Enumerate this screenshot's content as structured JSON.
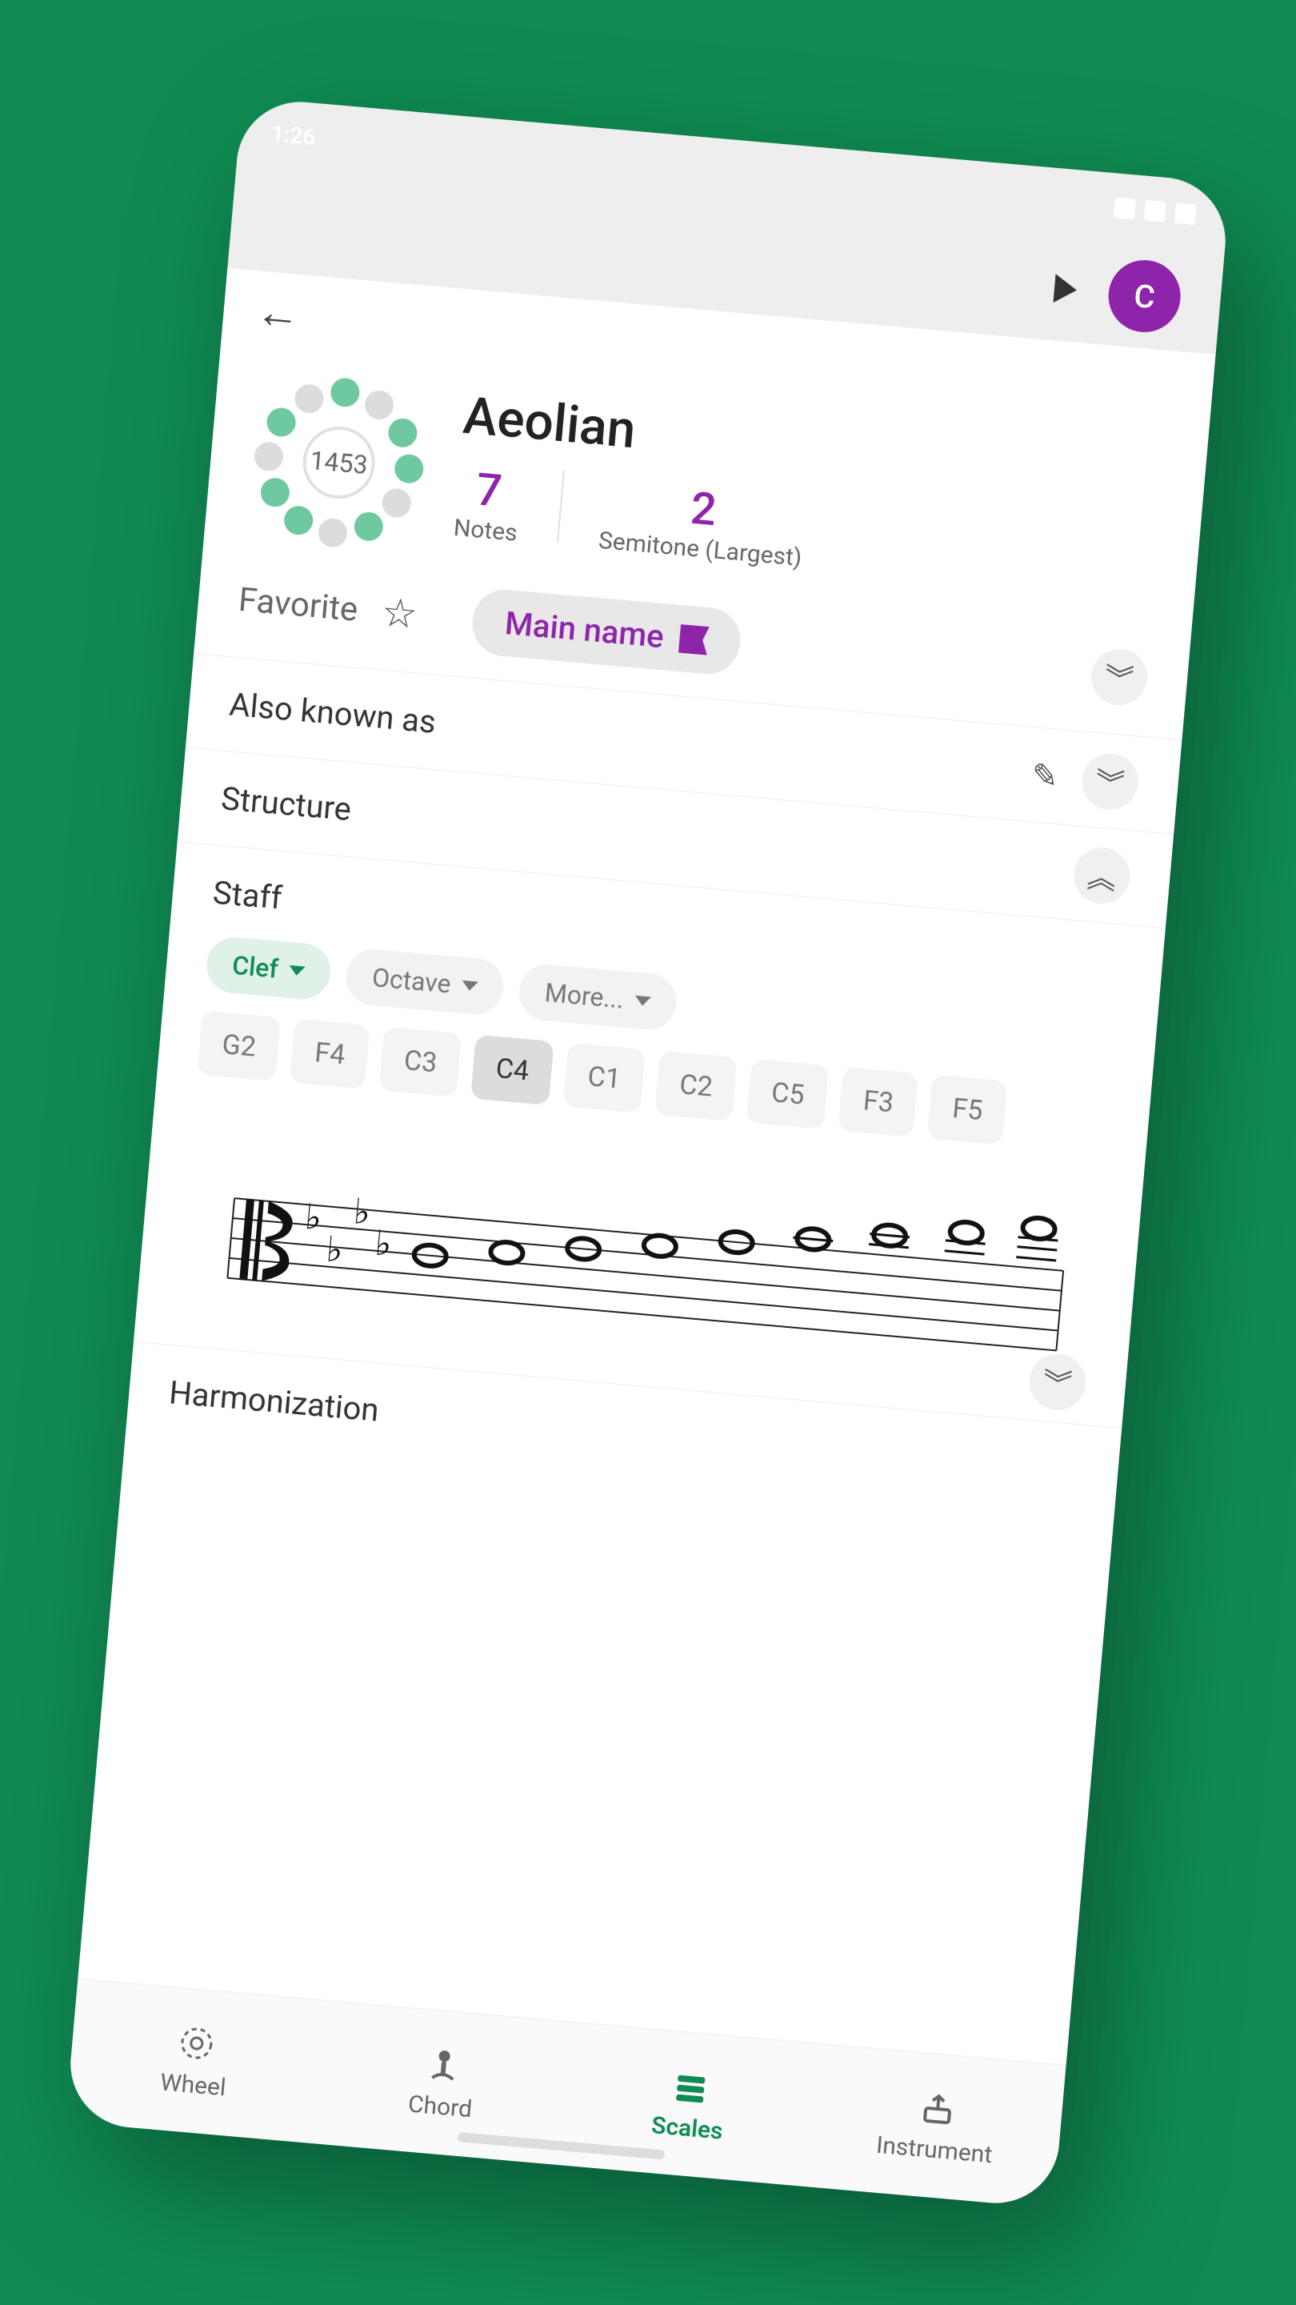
{
  "status": {
    "time": "1:26"
  },
  "header": {
    "avatar_letter": "C"
  },
  "hero": {
    "title": "Aeolian",
    "wheel_center": "1453",
    "notes": {
      "value": "7",
      "label": "Notes"
    },
    "semitone": {
      "value": "2",
      "label": "Semitone (Largest)"
    }
  },
  "favorite": {
    "label": "Favorite",
    "main_name": "Main name"
  },
  "sections": {
    "aka": "Also known as",
    "structure": "Structure",
    "staff": "Staff",
    "harmonization": "Harmonization"
  },
  "filters": {
    "clef": "Clef",
    "octave": "Octave",
    "more": "More..."
  },
  "clefs": [
    "G2",
    "F4",
    "C3",
    "C4",
    "C1",
    "C2",
    "C5",
    "F3",
    "F5"
  ],
  "clef_selected": "C4",
  "nav": {
    "wheel": "Wheel",
    "chord": "Chord",
    "scales": "Scales",
    "instrument": "Instrument"
  },
  "wheel_dots": [
    {
      "active": true
    },
    {
      "active": false
    },
    {
      "active": true
    },
    {
      "active": true
    },
    {
      "active": false
    },
    {
      "active": true
    },
    {
      "active": false
    },
    {
      "active": true
    },
    {
      "active": true
    },
    {
      "active": false
    },
    {
      "active": true
    },
    {
      "active": false
    }
  ]
}
